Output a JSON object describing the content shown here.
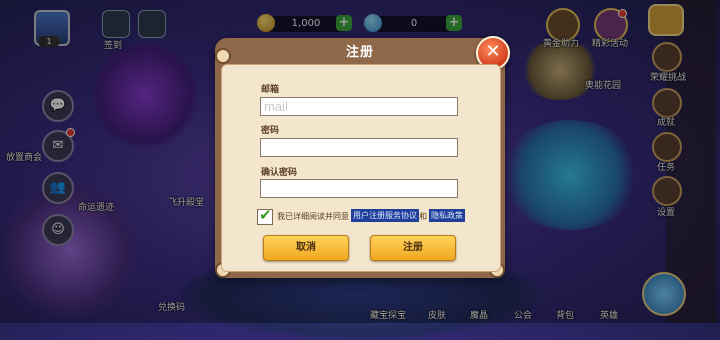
{
  "hud": {
    "avatar_level": "1",
    "gold_amount": "1,000",
    "gem_amount": "0",
    "left_labels": [
      "放置商会",
      "命运遗迹",
      "飞升殿堂",
      "兑换码"
    ],
    "top_labels": [
      "签到"
    ],
    "right_labels": [
      "黄金助力",
      "精彩活动",
      "荣耀挑战",
      "成就",
      "任务",
      "设置",
      "奥能花园"
    ],
    "bottom_labels": [
      "藏宝探宝",
      "皮肤",
      "魔晶",
      "公会",
      "背包",
      "英雄"
    ]
  },
  "dialog": {
    "title": "注册",
    "email_label": "邮箱",
    "email_placeholder": "mail",
    "password_label": "密码",
    "confirm_label": "确认密码",
    "agree_text": "我已详细阅读并同意",
    "terms_link": "用户注册服务协议",
    "and_text": "和",
    "privacy_link": "隐私政策",
    "cancel_label": "取消",
    "register_label": "注册",
    "agree_checked": true
  },
  "colors": {
    "dialog_frame": "#8e6848",
    "dialog_body": "#f4e6cc",
    "button": "#f0a820",
    "close_button": "#d2401e",
    "link_bg": "#1f3f9a"
  }
}
